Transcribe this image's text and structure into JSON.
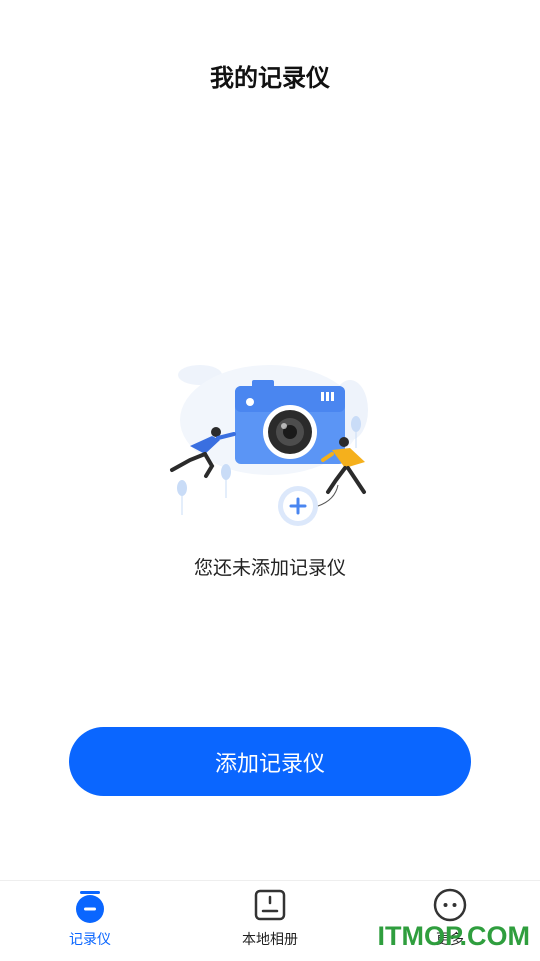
{
  "header": {
    "title": "我的记录仪"
  },
  "empty_state": {
    "illustration": "camera-with-people-illustration",
    "message": "您还未添加记录仪"
  },
  "actions": {
    "add_label": "添加记录仪"
  },
  "tabbar": {
    "items": [
      {
        "label": "记录仪",
        "icon": "recorder-icon",
        "active": true
      },
      {
        "label": "本地相册",
        "icon": "album-icon",
        "active": false
      },
      {
        "label": "更多",
        "icon": "more-icon",
        "active": false
      }
    ]
  },
  "watermark": {
    "text": "ITMOP.COM"
  },
  "colors": {
    "accent": "#0a66ff",
    "watermark": "#2f9e3e"
  }
}
